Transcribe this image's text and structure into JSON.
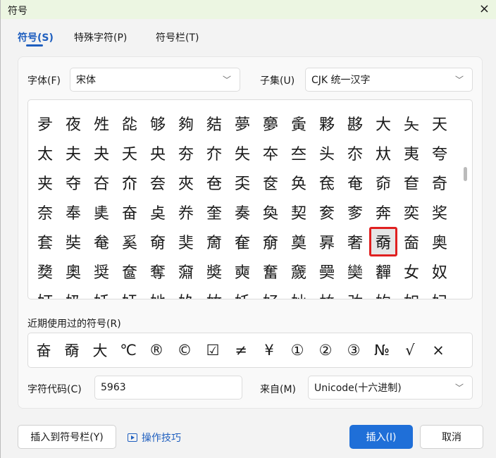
{
  "window": {
    "title": "符号",
    "close_icon": "×"
  },
  "tabs": [
    {
      "label": "符号(S)",
      "active": true
    },
    {
      "label": "特殊字符(P)"
    },
    {
      "label": "符号栏(T)"
    }
  ],
  "font": {
    "label": "字体(F)",
    "value": "宋体"
  },
  "subset": {
    "label": "子集(U)",
    "value": "CJK 统一汉字"
  },
  "grid": {
    "selected": "奣",
    "rows": [
      [
        "夛",
        "夜",
        "夝",
        "夞",
        "够",
        "夠",
        "夡",
        "夢",
        "夣",
        "夤",
        "夥",
        "夦",
        "大",
        "夨",
        "天"
      ],
      [
        "太",
        "夫",
        "夬",
        "夭",
        "央",
        "夯",
        "夰",
        "失",
        "夲",
        "夳",
        "头",
        "夵",
        "夶",
        "夷",
        "夸"
      ],
      [
        "夹",
        "夺",
        "夻",
        "夼",
        "夽",
        "夾",
        "夿",
        "奀",
        "奁",
        "奂",
        "奃",
        "奄",
        "奅",
        "奆",
        "奇"
      ],
      [
        "奈",
        "奉",
        "奊",
        "奋",
        "奌",
        "奍",
        "奎",
        "奏",
        "奐",
        "契",
        "奒",
        "奓",
        "奔",
        "奕",
        "奖"
      ],
      [
        "套",
        "奘",
        "奙",
        "奚",
        "奛",
        "奜",
        "奝",
        "奞",
        "奟",
        "奠",
        "奡",
        "奢",
        "奣",
        "奤",
        "奥"
      ],
      [
        "奦",
        "奧",
        "奨",
        "奩",
        "奪",
        "奫",
        "奬",
        "奭",
        "奮",
        "奯",
        "奰",
        "奱",
        "奲",
        "女",
        "奴"
      ],
      [
        "奵",
        "奶",
        "奷",
        "奸",
        "她",
        "奺",
        "奻",
        "奼",
        "好",
        "奾",
        "奿",
        "妀",
        "妁",
        "如",
        "妃"
      ]
    ]
  },
  "recent": {
    "label": "近期使用过的符号(R)",
    "symbols": [
      "奋",
      "奣",
      "大",
      "℃",
      "®",
      "©",
      "☑",
      "≠",
      "¥",
      "①",
      "②",
      "③",
      "№",
      "√",
      "×"
    ]
  },
  "code": {
    "label": "字符代码(C)",
    "value": "5963"
  },
  "from": {
    "label": "来自(M)",
    "value": "Unicode(十六进制)"
  },
  "buttons": {
    "add_to_bar": "插入到符号栏(Y)",
    "tips": "操作技巧",
    "insert": "插入(I)",
    "cancel": "取消"
  },
  "colors": {
    "accent": "#1f6fd8",
    "selection": "#e02020"
  }
}
